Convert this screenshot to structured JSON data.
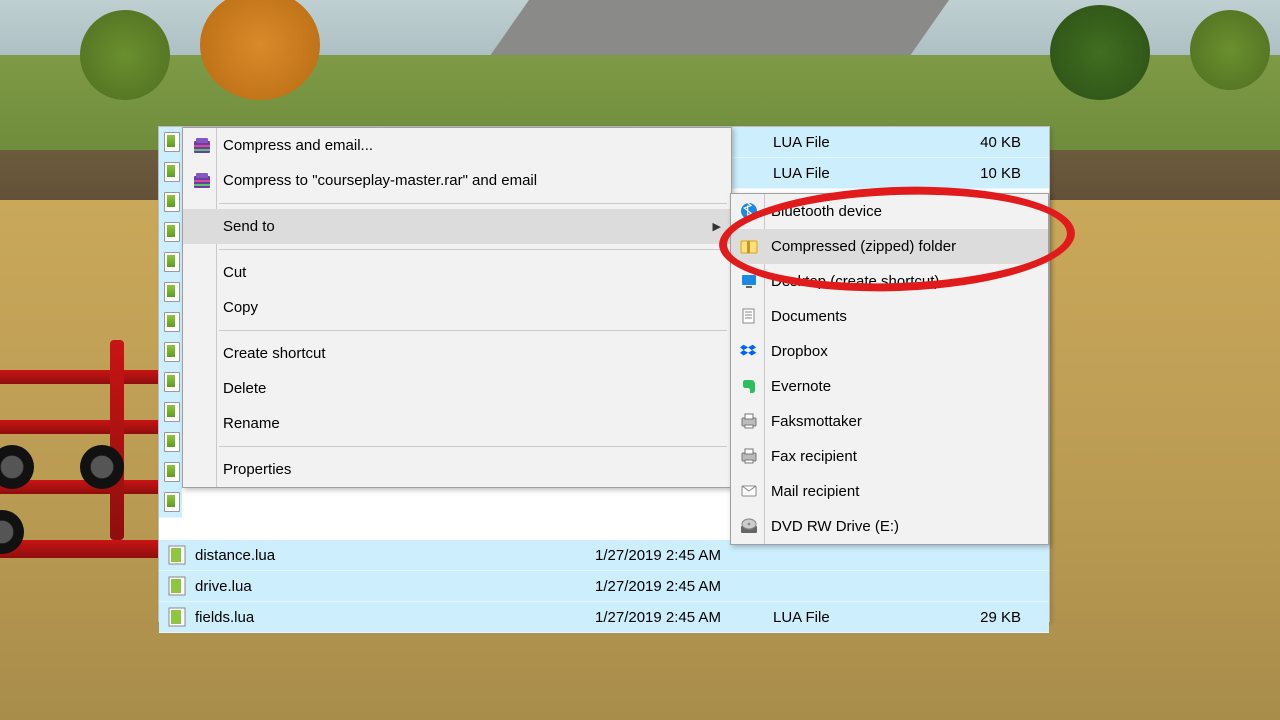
{
  "files_top": [
    {
      "type": "LUA File",
      "size": "40 KB"
    },
    {
      "type": "LUA File",
      "size": "10 KB"
    }
  ],
  "files_bottom": [
    {
      "name": "distance.lua",
      "date": "1/27/2019 2:45 AM",
      "type": "",
      "size": ""
    },
    {
      "name": "drive.lua",
      "date": "1/27/2019 2:45 AM",
      "type": "",
      "size": ""
    },
    {
      "name": "fields.lua",
      "date": "1/27/2019 2:45 AM",
      "type": "LUA File",
      "size": "29 KB"
    }
  ],
  "context_menu": {
    "compress_email": "Compress and email...",
    "compress_rar": "Compress to \"courseplay-master.rar\" and email",
    "send_to": "Send to",
    "cut": "Cut",
    "copy": "Copy",
    "create_shortcut": "Create shortcut",
    "delete": "Delete",
    "rename": "Rename",
    "properties": "Properties"
  },
  "send_to_menu": {
    "bluetooth": "Bluetooth device",
    "compressed": "Compressed (zipped) folder",
    "desktop": "Desktop (create shortcut)",
    "documents": "Documents",
    "dropbox": "Dropbox",
    "evernote": "Evernote",
    "faksmottaker": "Faksmottaker",
    "fax_recipient": "Fax recipient",
    "mail_recipient": "Mail recipient",
    "dvd_rw": "DVD RW Drive (E:)"
  },
  "highlight_target": "compressed"
}
